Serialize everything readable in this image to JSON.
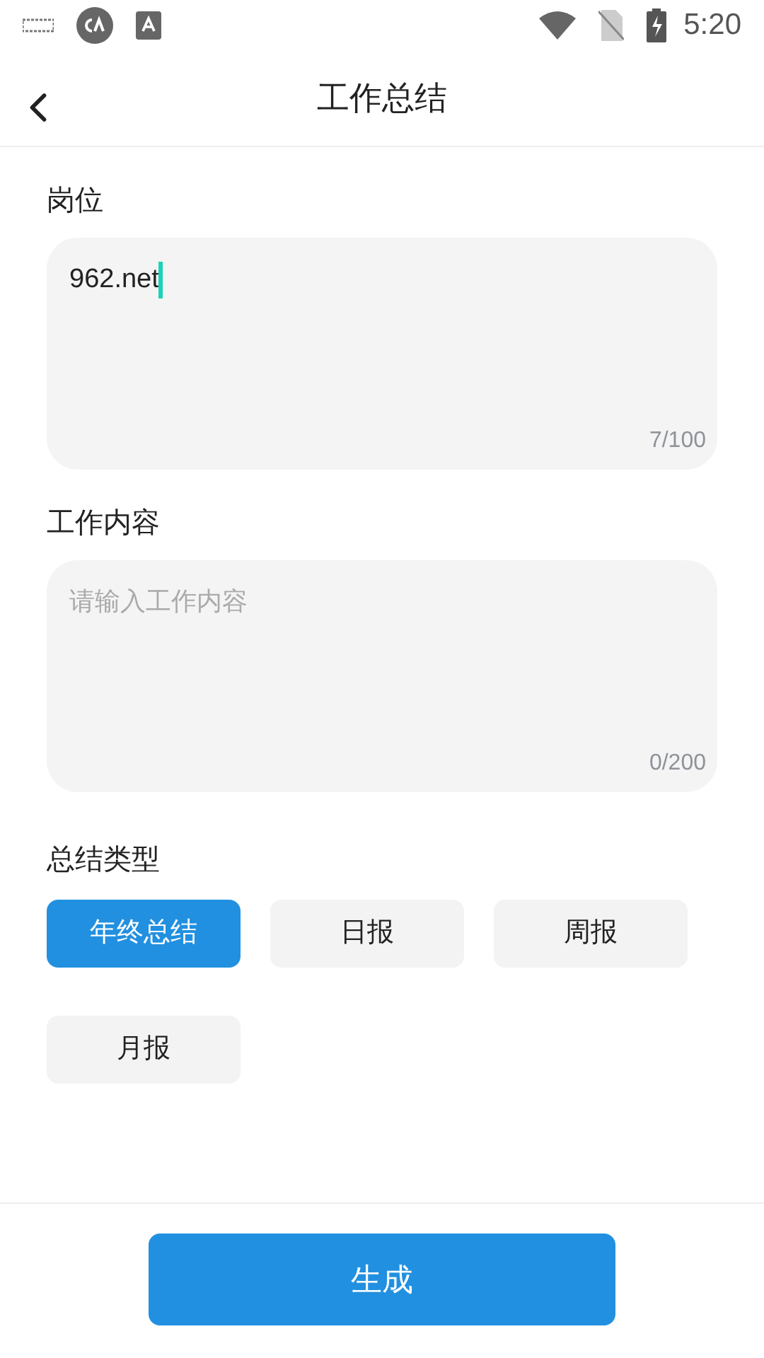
{
  "status_bar": {
    "time": "5:20"
  },
  "header": {
    "title": "工作总结"
  },
  "fields": [
    {
      "label": "岗位",
      "value": "962.net",
      "counter": "7/100",
      "focused": true
    },
    {
      "label": "工作内容",
      "placeholder": "请输入工作内容",
      "counter": "0/200",
      "focused": false
    }
  ],
  "summary_type": {
    "label": "总结类型",
    "options": [
      {
        "label": "年终总结",
        "selected": true
      },
      {
        "label": "日报",
        "selected": false
      },
      {
        "label": "周报",
        "selected": false
      },
      {
        "label": "月报",
        "selected": false
      }
    ]
  },
  "generate_button": "生成"
}
